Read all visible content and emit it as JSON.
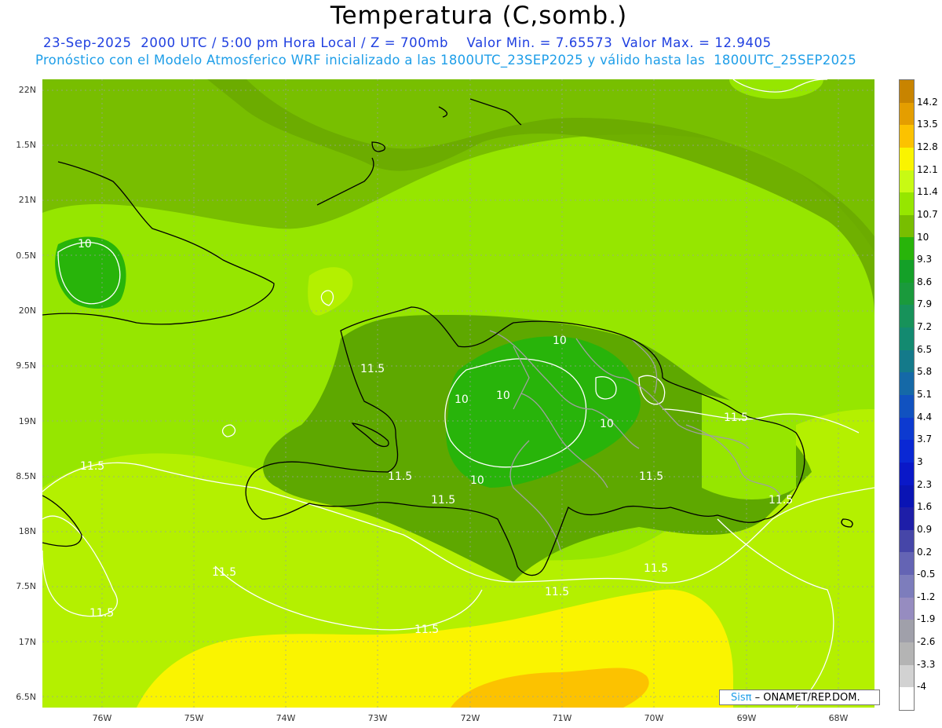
{
  "header": {
    "title": "Temperatura (C,somb.)",
    "line1": "23-Sep-2025  2000 UTC / 5:00 pm Hora Local / Z = 700mb    Valor Min. = 7.65573  Valor Max. = 12.9405",
    "line2": "Pronóstico con el Modelo Atmosferico WRF inicializado a las 1800UTC_23SEP2025 y válido hasta las  1800UTC_25SEP2025"
  },
  "map": {
    "lat_labels": [
      "22N",
      "1.5N",
      "21N",
      "0.5N",
      "20N",
      "9.5N",
      "19N",
      "8.5N",
      "18N",
      "7.5N",
      "17N",
      "6.5N"
    ],
    "lon_labels": [
      "76W",
      "75W",
      "74W",
      "73W",
      "72W",
      "71W",
      "70W",
      "69W",
      "68W"
    ],
    "contour_labels": [
      "10",
      "10",
      "10",
      "10",
      "10",
      "10",
      "11.5",
      "11.5",
      "11.5",
      "11.5",
      "11.5",
      "11.5",
      "11.5",
      "11.5",
      "11.5",
      "11.5",
      "11.5",
      "11.5"
    ]
  },
  "colorbar": {
    "labels": [
      "14.2",
      "13.5",
      "12.8",
      "12.1",
      "11.4",
      "10.7",
      "10",
      "9.3",
      "8.6",
      "7.9",
      "7.2",
      "6.5",
      "5.8",
      "5.1",
      "4.4",
      "3.7",
      "3",
      "2.3",
      "1.6",
      "0.9",
      "0.2",
      "-0.5",
      "-1.2",
      "-1.9",
      "-2.6",
      "-3.3",
      "-4"
    ],
    "colors": [
      "#c88400",
      "#e49e00",
      "#fcc200",
      "#faf400",
      "#c8fa14",
      "#96e600",
      "#78be00",
      "#28b40a",
      "#14a028",
      "#1a9a3c",
      "#17925a",
      "#138a70",
      "#147a8a",
      "#1569a7",
      "#1152c0",
      "#0d3ad0",
      "#0a28d4",
      "#0a18c8",
      "#0a14b4",
      "#1e1ea8",
      "#4646a8",
      "#6464b4",
      "#7d7dbc",
      "#968cc0",
      "#a0a0aa",
      "#b4b4b4",
      "#d2d2d2",
      "#ffffff"
    ]
  },
  "credit": {
    "sis": "Sisπ",
    "rest": " – ONAMET/REP.DOM."
  }
}
